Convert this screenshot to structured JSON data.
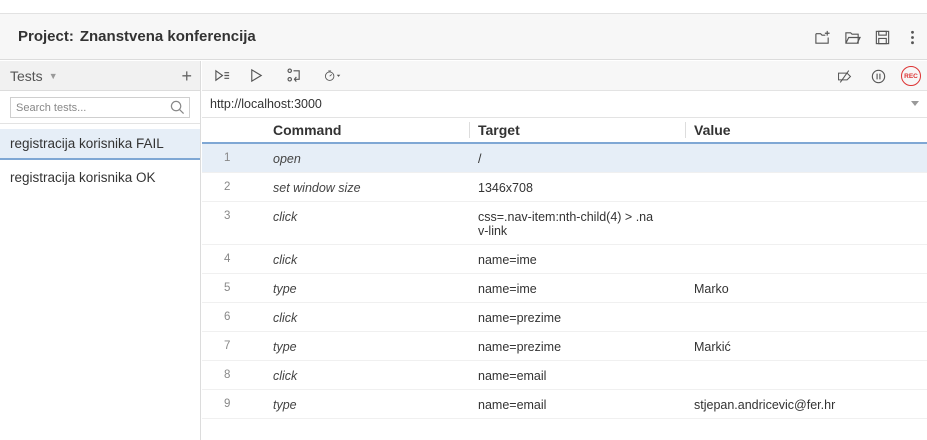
{
  "header": {
    "project_label": "Project:",
    "project_name": "Znanstvena konferencija",
    "icons": [
      "new-project-icon",
      "open-project-icon",
      "save-project-icon",
      "more-icon"
    ]
  },
  "sidebar": {
    "title": "Tests",
    "add_label": "+",
    "search_placeholder": "Search tests...",
    "tests": [
      {
        "name": "registracija korisnika FAIL",
        "selected": true
      },
      {
        "name": "registracija korisnika OK",
        "selected": false
      }
    ]
  },
  "toolbar": {
    "icons": [
      "run-all-tests-icon",
      "run-current-test-icon",
      "step-over-icon",
      "speed-icon"
    ],
    "right_icons": [
      "disable-breakpoints-icon",
      "pause-on-exceptions-icon"
    ],
    "rec_label": "REC"
  },
  "url": {
    "value": "http://localhost:3000"
  },
  "grid": {
    "headers": {
      "command": "Command",
      "target": "Target",
      "value": "Value"
    },
    "rows": [
      {
        "num": "1",
        "command": "open",
        "target": "/",
        "value": ""
      },
      {
        "num": "2",
        "command": "set window size",
        "target": "1346x708",
        "value": ""
      },
      {
        "num": "3",
        "command": "click",
        "target": "css=.nav-item:nth-child(4) > .na\nv-link",
        "value": ""
      },
      {
        "num": "4",
        "command": "click",
        "target": "name=ime",
        "value": ""
      },
      {
        "num": "5",
        "command": "type",
        "target": "name=ime",
        "value": "Marko"
      },
      {
        "num": "6",
        "command": "click",
        "target": "name=prezime",
        "value": ""
      },
      {
        "num": "7",
        "command": "type",
        "target": "name=prezime",
        "value": "Markić"
      },
      {
        "num": "8",
        "command": "click",
        "target": "name=email",
        "value": ""
      },
      {
        "num": "9",
        "command": "type",
        "target": "name=email",
        "value": "stjepan.andricevic@fer.hr"
      }
    ],
    "selected_row": 0
  },
  "colors": {
    "accent": "#7fa7d4",
    "selected_bg": "#e6eef7",
    "rec": "#dd3333"
  }
}
